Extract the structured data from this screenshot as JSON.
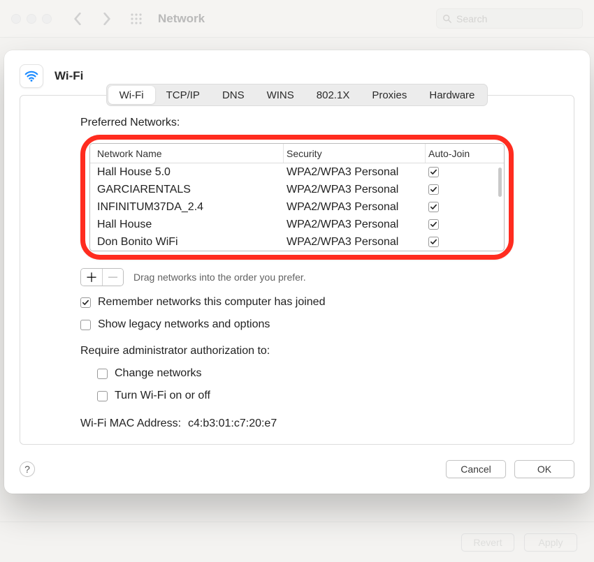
{
  "window": {
    "title": "Network",
    "search_placeholder": "Search"
  },
  "bottom": {
    "revert": "Revert",
    "apply": "Apply"
  },
  "sheet": {
    "title": "Wi-Fi",
    "tabs": [
      "Wi-Fi",
      "TCP/IP",
      "DNS",
      "WINS",
      "802.1X",
      "Proxies",
      "Hardware"
    ],
    "active_tab": 0,
    "preferred_label": "Preferred Networks:",
    "columns": {
      "name": "Network Name",
      "security": "Security",
      "auto": "Auto-Join"
    },
    "networks": [
      {
        "name": "Hall House 5.0",
        "security": "WPA2/WPA3 Personal",
        "auto": true
      },
      {
        "name": "GARCIARENTALS",
        "security": "WPA2/WPA3 Personal",
        "auto": true
      },
      {
        "name": "INFINITUM37DA_2.4",
        "security": "WPA2/WPA3 Personal",
        "auto": true
      },
      {
        "name": "Hall House",
        "security": "WPA2/WPA3 Personal",
        "auto": true
      },
      {
        "name": "Don Bonito WiFi",
        "security": "WPA2/WPA3 Personal",
        "auto": true
      }
    ],
    "drag_hint": "Drag networks into the order you prefer.",
    "opt_remember": "Remember networks this computer has joined",
    "opt_legacy": "Show legacy networks and options",
    "require_label": "Require administrator authorization to:",
    "opt_change": "Change networks",
    "opt_toggle": "Turn Wi-Fi on or off",
    "mac_label": "Wi-Fi MAC Address:",
    "mac_value": "c4:b3:01:c7:20:e7",
    "checks": {
      "remember": true,
      "legacy": false,
      "change": false,
      "toggle": false
    },
    "buttons": {
      "cancel": "Cancel",
      "ok": "OK",
      "help": "?",
      "add": "＋",
      "remove": "－"
    }
  }
}
